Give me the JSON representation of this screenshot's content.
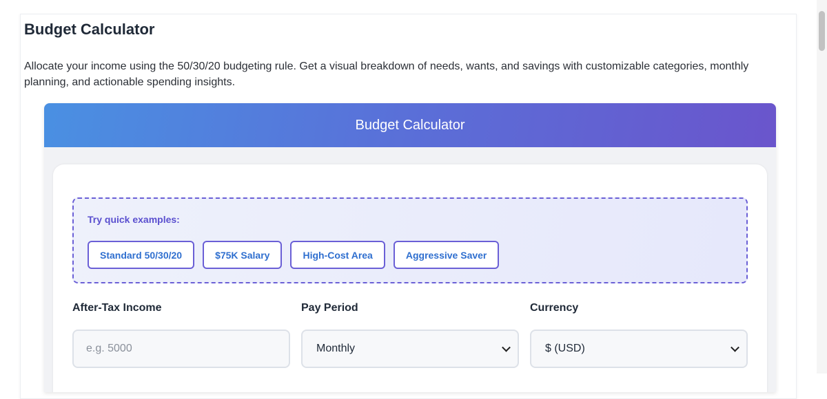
{
  "page": {
    "title": "Budget Calculator",
    "intro": "Allocate your income using the 50/30/20 budgeting rule. Get a visual breakdown of needs, wants, and savings with customizable categories, monthly planning, and actionable spending insights."
  },
  "calculator": {
    "header_title": "Budget Calculator",
    "examples_label": "Try quick examples:",
    "examples": [
      "Standard 50/30/20",
      "$75K Salary",
      "High-Cost Area",
      "Aggressive Saver"
    ]
  },
  "form": {
    "income_label": "After-Tax Income",
    "income_placeholder": "e.g. 5000",
    "income_value": "",
    "period_label": "Pay Period",
    "period_value": "Monthly",
    "currency_label": "Currency",
    "currency_value": "$ (USD)"
  },
  "colors": {
    "accent": "#6a5fd6",
    "chip_text": "#2f6fcf",
    "header_gradient_start": "#4a90e2",
    "header_gradient_end": "#6a55cc"
  },
  "icons": {
    "select_arrow": "chevron-down-icon"
  }
}
